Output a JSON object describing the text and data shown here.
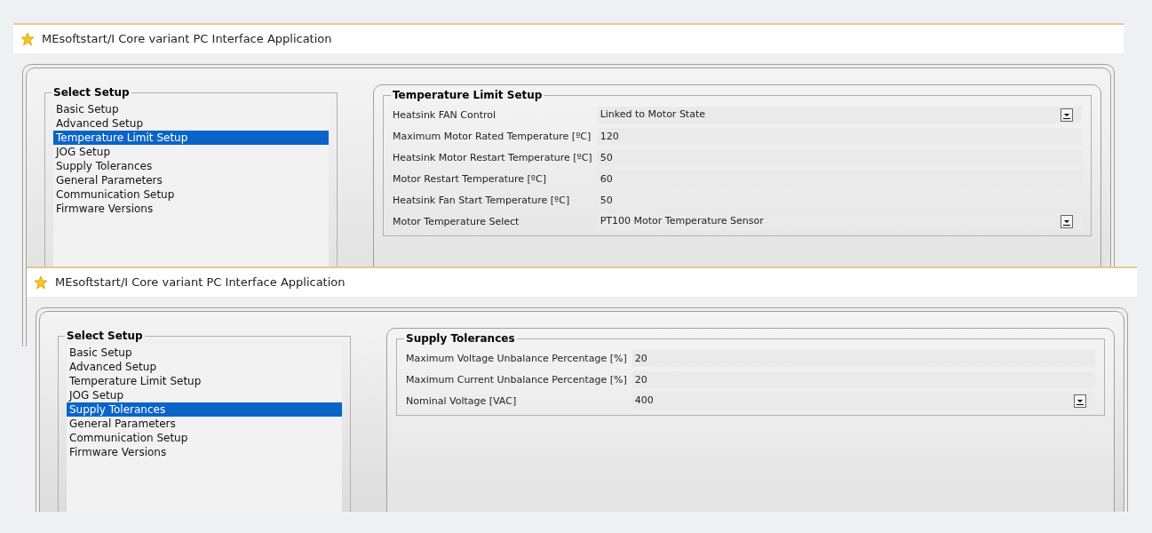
{
  "windows": [
    {
      "title": "MEsoftstart/I Core variant PC Interface Application",
      "select_setup": {
        "title": "Select Setup",
        "items": [
          {
            "label": "Basic Setup",
            "selected": false
          },
          {
            "label": "Advanced Setup",
            "selected": false
          },
          {
            "label": "Temperature Limit Setup",
            "selected": true
          },
          {
            "label": "JOG Setup",
            "selected": false
          },
          {
            "label": "Supply Tolerances",
            "selected": false
          },
          {
            "label": "General Parameters",
            "selected": false
          },
          {
            "label": "Communication Setup",
            "selected": false
          },
          {
            "label": "Firmware Versions",
            "selected": false
          }
        ]
      },
      "panel": {
        "title": "Temperature Limit Setup",
        "rows": [
          {
            "kind": "dropdown",
            "label": "Heatsink FAN Control",
            "value": "Linked to Motor State"
          },
          {
            "kind": "text",
            "label": "Maximum Motor Rated Temperature [ºC]",
            "value": "120"
          },
          {
            "kind": "text",
            "label": "Heatsink Motor Restart Temperature [ºC]",
            "value": "50"
          },
          {
            "kind": "text",
            "label": "Motor Restart Temperature [ºC]",
            "value": "60"
          },
          {
            "kind": "text",
            "label": "Heatsink Fan Start Temperature [ºC]",
            "value": "50"
          },
          {
            "kind": "dropdown",
            "label": "Motor Temperature Select",
            "value": "PT100 Motor Temperature Sensor"
          }
        ]
      }
    },
    {
      "title": "MEsoftstart/I Core variant PC Interface Application",
      "select_setup": {
        "title": "Select Setup",
        "items": [
          {
            "label": "Basic Setup",
            "selected": false
          },
          {
            "label": "Advanced Setup",
            "selected": false
          },
          {
            "label": "Temperature Limit Setup",
            "selected": false
          },
          {
            "label": "JOG Setup",
            "selected": false
          },
          {
            "label": "Supply Tolerances",
            "selected": true
          },
          {
            "label": "General Parameters",
            "selected": false
          },
          {
            "label": "Communication Setup",
            "selected": false
          },
          {
            "label": "Firmware Versions",
            "selected": false
          }
        ]
      },
      "panel": {
        "title": "Supply Tolerances",
        "rows": [
          {
            "kind": "text",
            "label": "Maximum Voltage Unbalance Percentage [%]",
            "value": "20"
          },
          {
            "kind": "text",
            "label": "Maximum Current Unbalance Percentage [%]",
            "value": "20"
          },
          {
            "kind": "dropdown",
            "label": "Nominal Voltage [VAC]",
            "value": "400"
          }
        ]
      }
    }
  ]
}
